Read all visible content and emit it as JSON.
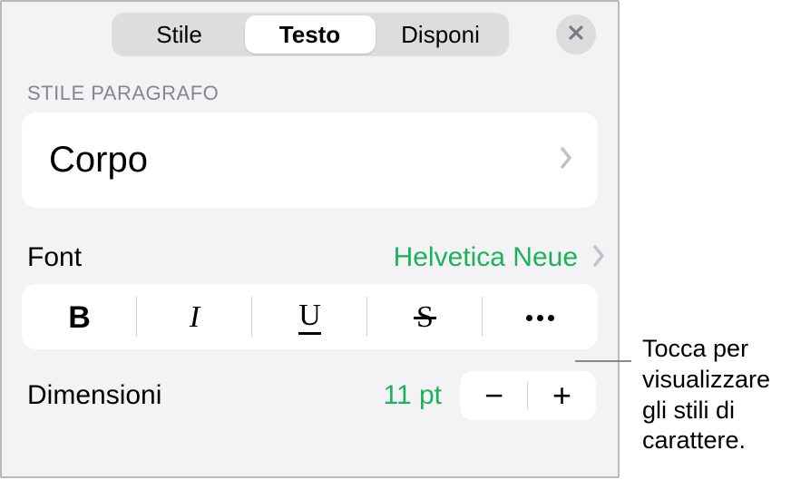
{
  "tabs": {
    "style": "Stile",
    "text": "Testo",
    "arrange": "Disponi"
  },
  "paragraph": {
    "section_label": "STILE PARAGRAFO",
    "value": "Corpo"
  },
  "font": {
    "label": "Font",
    "value": "Helvetica Neue"
  },
  "style_glyphs": {
    "bold": "B",
    "italic": "I",
    "underline": "U",
    "strike": "S"
  },
  "size": {
    "label": "Dimensioni",
    "value": "11 pt"
  },
  "callout": {
    "line1": "Tocca per",
    "line2": "visualizzare",
    "line3": "gli stili di",
    "line4": "carattere."
  }
}
